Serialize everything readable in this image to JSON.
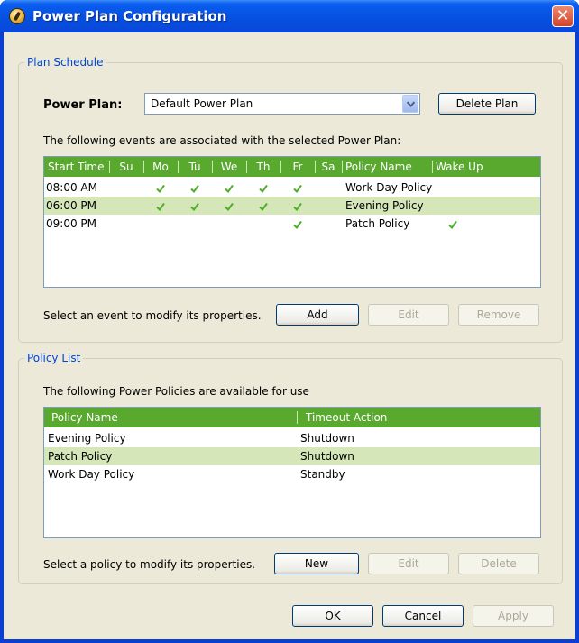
{
  "window": {
    "title": "Power Plan Configuration",
    "close_label": "✕"
  },
  "plan_schedule": {
    "legend": "Plan Schedule",
    "power_plan_label": "Power Plan:",
    "power_plan_value": "Default Power Plan",
    "delete_plan_label": "Delete Plan",
    "events_description": "The following events are associated with the selected Power Plan:",
    "columns": [
      "Start Time",
      "Su",
      "Mo",
      "Tu",
      "We",
      "Th",
      "Fr",
      "Sa",
      "Policy Name",
      "Wake Up"
    ],
    "events": [
      {
        "start": "08:00 AM",
        "days": [
          false,
          true,
          true,
          true,
          true,
          true,
          false
        ],
        "policy": "Work Day Policy",
        "wake_up": false,
        "selected": false
      },
      {
        "start": "06:00 PM",
        "days": [
          false,
          true,
          true,
          true,
          true,
          true,
          false
        ],
        "policy": "Evening Policy",
        "wake_up": false,
        "selected": true
      },
      {
        "start": "09:00 PM",
        "days": [
          false,
          false,
          false,
          false,
          false,
          true,
          false
        ],
        "policy": "Patch Policy",
        "wake_up": true,
        "selected": false
      }
    ],
    "hint": "Select an event to modify its properties.",
    "add_label": "Add",
    "edit_label": "Edit",
    "remove_label": "Remove"
  },
  "policy_list": {
    "legend": "Policy List",
    "description": "The following Power Policies are available for use",
    "columns": [
      "Policy Name",
      "Timeout Action"
    ],
    "policies": [
      {
        "name": "Evening Policy",
        "action": "Shutdown",
        "selected": false
      },
      {
        "name": "Patch Policy",
        "action": "Shutdown",
        "selected": true
      },
      {
        "name": "Work Day Policy",
        "action": "Standby",
        "selected": false
      }
    ],
    "hint": "Select a policy to modify its properties.",
    "new_label": "New",
    "edit_label": "Edit",
    "delete_label": "Delete"
  },
  "footer": {
    "ok_label": "OK",
    "cancel_label": "Cancel",
    "apply_label": "Apply"
  },
  "colors": {
    "header_green": "#5aa92f",
    "selected_row": "#d5e7b9",
    "check_green": "#4caf2a",
    "legend_blue": "#0046d5"
  }
}
